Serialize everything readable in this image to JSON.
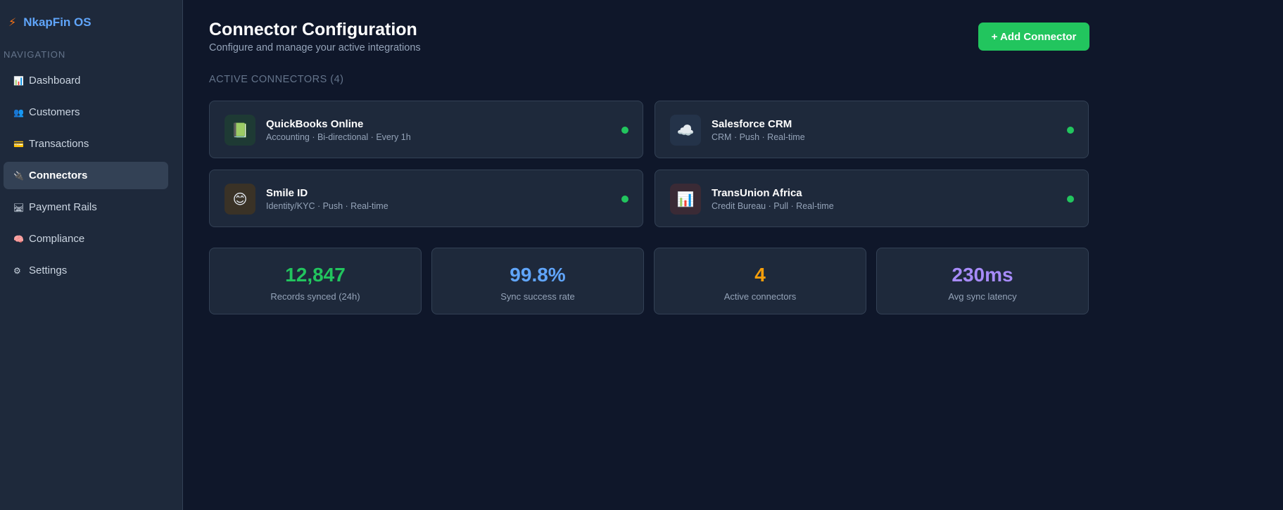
{
  "app": {
    "name": "NkapFin OS",
    "logo_icon": "⚡"
  },
  "sidebar": {
    "section_title": "NAVIGATION",
    "items": [
      {
        "label": "Dashboard",
        "icon": "📊",
        "active": false
      },
      {
        "label": "Customers",
        "icon": "👥",
        "active": false
      },
      {
        "label": "Transactions",
        "icon": "💳",
        "active": false
      },
      {
        "label": "Connectors",
        "icon": "🔌",
        "active": true
      },
      {
        "label": "Payment Rails",
        "icon": "🛤",
        "active": false
      },
      {
        "label": "Compliance",
        "icon": "🧠",
        "active": false
      },
      {
        "label": "Settings",
        "icon": "⚙",
        "active": false
      }
    ]
  },
  "header": {
    "title": "Connector Configuration",
    "subtitle": "Configure and manage your active integrations",
    "add_button_label": "+ Add Connector"
  },
  "connectors": {
    "section_label": "ACTIVE CONNECTORS (4)",
    "items": [
      {
        "name": "QuickBooks Online",
        "meta": "Accounting · Bi-directional · Every 1h",
        "icon": "📗",
        "icon_bg": "#1e3a34",
        "status": "active"
      },
      {
        "name": "Salesforce CRM",
        "meta": "CRM · Push · Real-time",
        "icon": "☁️",
        "icon_bg": "#243349",
        "status": "active"
      },
      {
        "name": "Smile ID",
        "meta": "Identity/KYC · Push · Real-time",
        "icon": "😊",
        "icon_bg": "#3a3226",
        "status": "active"
      },
      {
        "name": "TransUnion Africa",
        "meta": "Credit Bureau · Pull · Real-time",
        "icon": "📊",
        "icon_bg": "#3a2a35",
        "status": "active"
      }
    ]
  },
  "stats": [
    {
      "value": "12,847",
      "label": "Records synced (24h)",
      "color": "#22c55e"
    },
    {
      "value": "99.8%",
      "label": "Sync success rate",
      "color": "#60a5fa"
    },
    {
      "value": "4",
      "label": "Active connectors",
      "color": "#f59e0b"
    },
    {
      "value": "230ms",
      "label": "Avg sync latency",
      "color": "#a78bfa"
    }
  ],
  "colors": {
    "accent": "#22c55e",
    "background": "#0f172a",
    "surface": "#1e293b",
    "status_active": "#22c55e"
  }
}
